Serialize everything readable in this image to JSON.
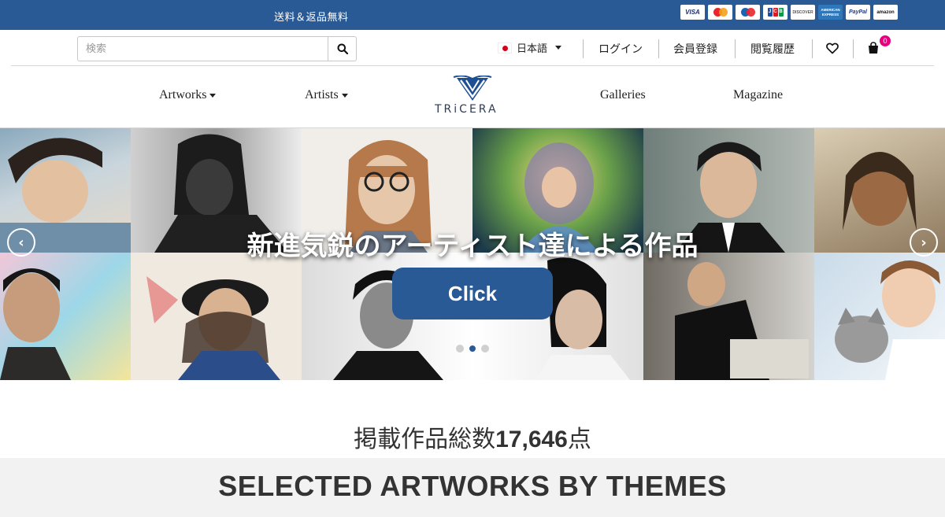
{
  "topbar": {
    "promo": "送料＆返品無料",
    "payment_methods": [
      {
        "name": "visa",
        "label": "VISA"
      },
      {
        "name": "mastercard",
        "label": ""
      },
      {
        "name": "mastercard-debit",
        "label": ""
      },
      {
        "name": "jcb",
        "label": "JCB"
      },
      {
        "name": "discover",
        "label": "DISCOVER"
      },
      {
        "name": "american-express",
        "label": "AMERICAN EXPRESS"
      },
      {
        "name": "paypal",
        "label": "PayPal"
      },
      {
        "name": "amazon-pay",
        "label": "amazon"
      }
    ]
  },
  "header": {
    "search_placeholder": "検索",
    "search_value": "",
    "language": "日本語",
    "login": "ログイン",
    "signup": "会員登録",
    "history": "閲覧履歴",
    "cart_count": "0"
  },
  "nav": {
    "artworks": "Artworks",
    "artists": "Artists",
    "logo_text": "TRiCERA",
    "galleries": "Galleries",
    "magazine": "Magazine"
  },
  "hero": {
    "title": "新進気鋭のアーティスト達による作品",
    "button": "Click",
    "prev": "‹",
    "next": "›",
    "slide_count": 3,
    "active_slide": 2
  },
  "stats": {
    "prefix": "掲載作品総数",
    "count": "17,646",
    "suffix": "点"
  },
  "section": {
    "title": "SELECTED ARTWORKS BY THEMES"
  },
  "colors": {
    "brand_blue": "#2a5a96",
    "badge_pink": "#e8007f"
  }
}
